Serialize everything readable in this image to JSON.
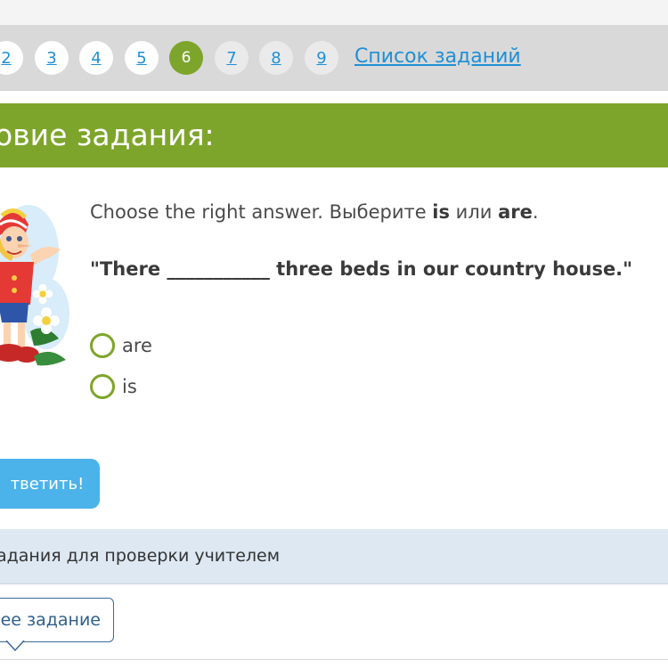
{
  "pager": {
    "pages": [
      {
        "label": "2",
        "state": "link"
      },
      {
        "label": "3",
        "state": "link"
      },
      {
        "label": "4",
        "state": "link"
      },
      {
        "label": "5",
        "state": "link"
      },
      {
        "label": "6",
        "state": "current"
      },
      {
        "label": "7",
        "state": "visited"
      },
      {
        "label": "8",
        "state": "visited"
      },
      {
        "label": "9",
        "state": "visited"
      }
    ],
    "task_list_label": "Список заданий"
  },
  "title": "овие задания:",
  "question": {
    "instruction_prefix": "Choose the right answer. Выберите ",
    "word_is": "is",
    "instruction_or": " или ",
    "word_are": "are",
    "instruction_end": ".",
    "sentence": "\"There ___________ three beds in our country house.\""
  },
  "options": [
    {
      "label": "are",
      "selected": false
    },
    {
      "label": "is",
      "selected": false
    }
  ],
  "answer_button_label": "тветить!",
  "teacher_note": "адания для проверки учителем",
  "prev_button_label": "нее задание",
  "colors": {
    "accent_green": "#7ea52b",
    "link_blue": "#1e90d6",
    "button_blue": "#4bb3ea",
    "teacher_bar": "#dde8f3"
  }
}
